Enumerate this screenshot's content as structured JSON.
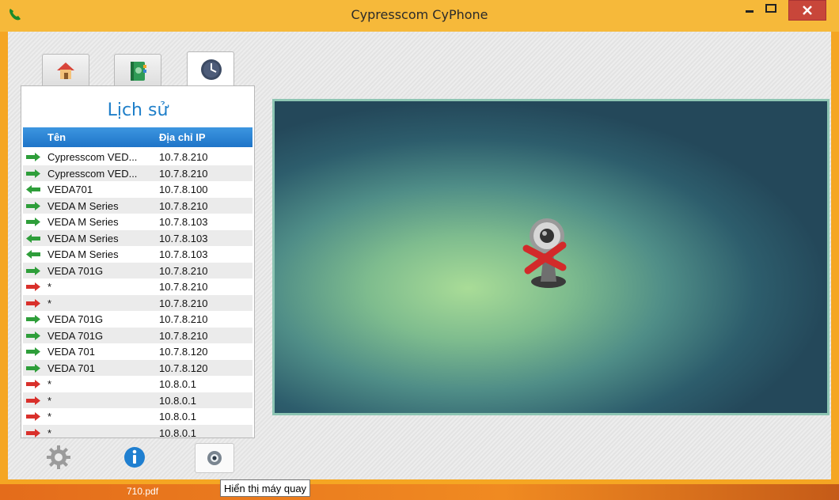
{
  "window": {
    "title": "Cypresscom CyPhone"
  },
  "icons": {
    "app": "phone-handset-icon",
    "tab_home": "home-icon",
    "tab_contacts": "address-book-icon",
    "tab_history": "clock-icon",
    "settings": "gear-icon",
    "info": "info-icon",
    "camera": "camera-icon",
    "no_camera": "webcam-disabled-icon",
    "incoming": "arrow-left-green-icon",
    "outgoing": "arrow-right-green-icon",
    "missed": "arrow-right-red-icon"
  },
  "history": {
    "title": "Lịch sử",
    "columns": {
      "name": "Tên",
      "ip": "Địa chỉ IP"
    },
    "rows": [
      {
        "name": "Cypresscom VED...",
        "ip": "10.7.8.210",
        "dir": "outgoing"
      },
      {
        "name": "Cypresscom VED...",
        "ip": "10.7.8.210",
        "dir": "outgoing"
      },
      {
        "name": "VEDA701",
        "ip": "10.7.8.100",
        "dir": "incoming"
      },
      {
        "name": "VEDA M Series",
        "ip": "10.7.8.210",
        "dir": "outgoing"
      },
      {
        "name": "VEDA M Series",
        "ip": "10.7.8.103",
        "dir": "outgoing"
      },
      {
        "name": "VEDA M Series",
        "ip": "10.7.8.103",
        "dir": "incoming"
      },
      {
        "name": "VEDA M Series",
        "ip": "10.7.8.103",
        "dir": "incoming"
      },
      {
        "name": "VEDA 701G",
        "ip": "10.7.8.210",
        "dir": "outgoing"
      },
      {
        "name": "*",
        "ip": "10.7.8.210",
        "dir": "missed"
      },
      {
        "name": "*",
        "ip": "10.7.8.210",
        "dir": "missed"
      },
      {
        "name": "VEDA 701G",
        "ip": "10.7.8.210",
        "dir": "outgoing"
      },
      {
        "name": "VEDA 701G",
        "ip": "10.7.8.210",
        "dir": "outgoing"
      },
      {
        "name": "VEDA 701",
        "ip": "10.7.8.120",
        "dir": "outgoing"
      },
      {
        "name": "VEDA 701",
        "ip": "10.7.8.120",
        "dir": "outgoing"
      },
      {
        "name": "*",
        "ip": "10.8.0.1",
        "dir": "missed"
      },
      {
        "name": "*",
        "ip": "10.8.0.1",
        "dir": "missed"
      },
      {
        "name": "*",
        "ip": "10.8.0.1",
        "dir": "missed"
      },
      {
        "name": "*",
        "ip": "10.8.0.1",
        "dir": "missed"
      }
    ]
  },
  "tooltip": {
    "text": "Hiển thị máy quay"
  },
  "taskbar": {
    "file_label": "710.pdf"
  },
  "colors": {
    "accent": "#1f7fc9",
    "incoming": "#2e9e3a",
    "missed": "#d9302b"
  }
}
